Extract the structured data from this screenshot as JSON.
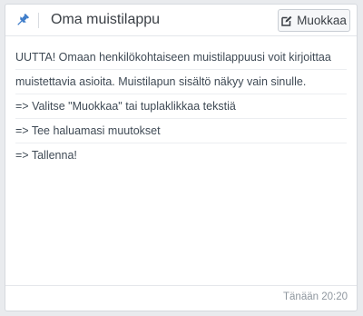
{
  "header": {
    "icon": "pin-icon",
    "title": "Oma muistilappu",
    "edit_button": {
      "icon": "edit-icon",
      "label": "Muokkaa"
    }
  },
  "note": {
    "lines": [
      "UUTTA!  Omaan henkilökohtaiseen muistilappuusi voit kirjoittaa",
      "muistettavia asioita. Muistilapun sisältö näkyy vain sinulle.",
      "=> Valitse \"Muokkaa\" tai tuplaklikkaa tekstiä",
      "=> Tee haluamasi muutokset",
      "=> Tallenna!"
    ]
  },
  "footer": {
    "timestamp": "Tänään 20:20"
  },
  "colors": {
    "accent": "#3d7cc9",
    "text": "#3f4a55",
    "muted": "#8f979f"
  }
}
